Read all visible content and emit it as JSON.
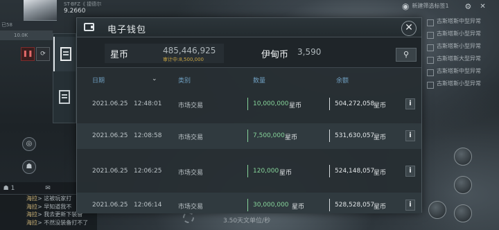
{
  "hud": {
    "corp_tag": "ST-BFZ《 捷德尔",
    "isk": "9.2660",
    "left_stat": "已58",
    "left_strip": "10.0K"
  },
  "wallet": {
    "title": "电子钱包",
    "close_label": "✕",
    "star_coin_label": "星币",
    "star_coin_value": "485,446,925",
    "star_coin_sub": "审计中:8,500,000",
    "eden_coin_label": "伊甸币",
    "eden_coin_value": "3,590",
    "filter_icon": "filter-icon"
  },
  "columns": {
    "date": "日期",
    "category": "类别",
    "amount": "数量",
    "balance": "余额"
  },
  "rows": [
    {
      "date": "2021.06.25",
      "time": "12:48:01",
      "category": "市场交易",
      "amount": "10,000,000",
      "unit": "星币",
      "balance": "504,272,058",
      "balance_unit": "星币",
      "info": "i"
    },
    {
      "date": "2021.06.25",
      "time": "12:08:58",
      "category": "市场交易",
      "amount": "7,500,000",
      "unit": "星币",
      "balance": "531,630,057",
      "balance_unit": "星币",
      "info": "i"
    },
    {
      "date": "2021.06.25",
      "time": "12:06:25",
      "category": "市场交易",
      "amount": "120,000",
      "unit": "星币",
      "balance": "524,148,057",
      "balance_unit": "星币",
      "info": "i"
    },
    {
      "date": "2021.06.25",
      "time": "12:06:14",
      "category": "市场交易",
      "amount": "30,000,000",
      "unit": "星币",
      "balance": "528,528,057",
      "balance_unit": "星币",
      "info": "i"
    }
  ],
  "right_panel": {
    "filter_text": "新建筛选标签1",
    "items": [
      "古斯塔斯中型异常",
      "古斯塔斯小型异常",
      "古斯塔斯小型异常",
      "古斯塔斯大型异常",
      "古斯塔斯中型异常",
      "古斯塔斯小型异常"
    ]
  },
  "chat": {
    "count": "1",
    "lines": [
      {
        "who": "海拉",
        "text": "> 这被玩家打"
      },
      {
        "who": "海拉",
        "text": "> 早知道我不"
      },
      {
        "who": "海拉",
        "text": "> 我去更新下装备"
      },
      {
        "who": "海拉",
        "text": "> 不然没装备打不了"
      }
    ]
  },
  "bottom": {
    "distance": "3.50天文单位/秒"
  },
  "colors": {
    "amount_green": "#86d49a",
    "column_blue": "#6f9fc1",
    "audit_gold": "#c9a542"
  }
}
